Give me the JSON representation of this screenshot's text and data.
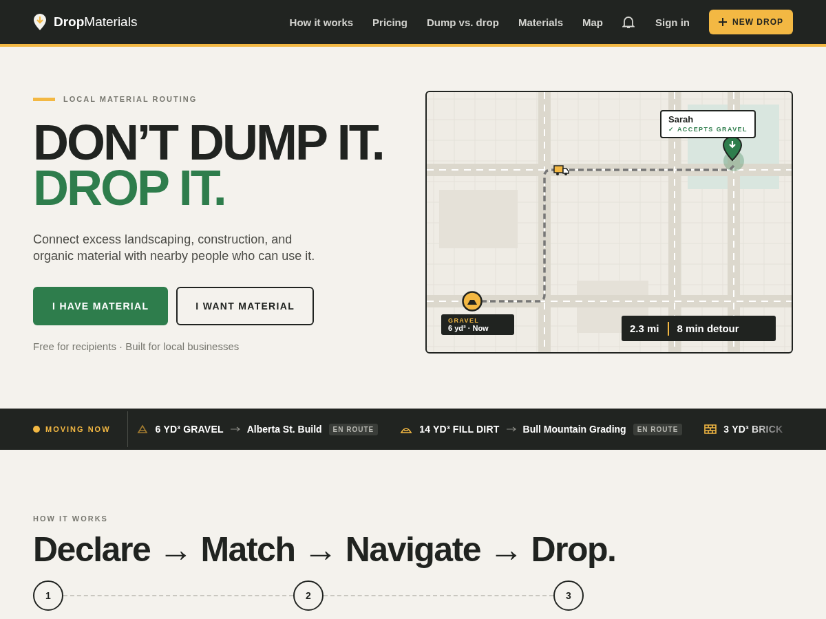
{
  "nav": {
    "brand_bold": "Drop",
    "brand_rest": "Materials",
    "links": [
      "How it works",
      "Pricing",
      "Dump vs. drop",
      "Materials",
      "Map"
    ],
    "sign_in": "Sign in",
    "cta": "NEW DROP"
  },
  "hero": {
    "eyebrow": "LOCAL MATERIAL ROUTING",
    "headline_1": "DON’T DUMP IT.",
    "headline_2": "DROP IT.",
    "lead": "Connect excess landscaping, construction, and organic material with nearby people who can use it.",
    "buttons": [
      {
        "label": "I HAVE MATERIAL",
        "kind": "primary"
      },
      {
        "label": "I WANT MATERIAL",
        "kind": "outline"
      }
    ],
    "note": "Free for recipients · Built for local businesses"
  },
  "map": {
    "recipient": {
      "name": "Sarah",
      "status": "✓ ACCEPTS GRAVEL"
    },
    "source": {
      "material": "GRAVEL",
      "detail": "6 yd³ · Now"
    },
    "route": {
      "distance": "2.3 mi",
      "detour": "8 min detour"
    }
  },
  "ticker": {
    "label": "MOVING NOW",
    "items": [
      {
        "kind": "gravel",
        "material": "6 YD³ GRAVEL",
        "destination": "Alberta St. Build",
        "status": "EN ROUTE"
      },
      {
        "kind": "dirt",
        "material": "14 YD³ FILL DIRT",
        "destination": "Bull Mountain Grading",
        "status": "EN ROUTE"
      },
      {
        "kind": "brick",
        "material": "3 YD³ BRICK"
      }
    ]
  },
  "how": {
    "eyebrow": "HOW IT WORKS",
    "title": "Declare → Match → Navigate → Drop.",
    "steps": [
      "1",
      "2",
      "3"
    ]
  }
}
